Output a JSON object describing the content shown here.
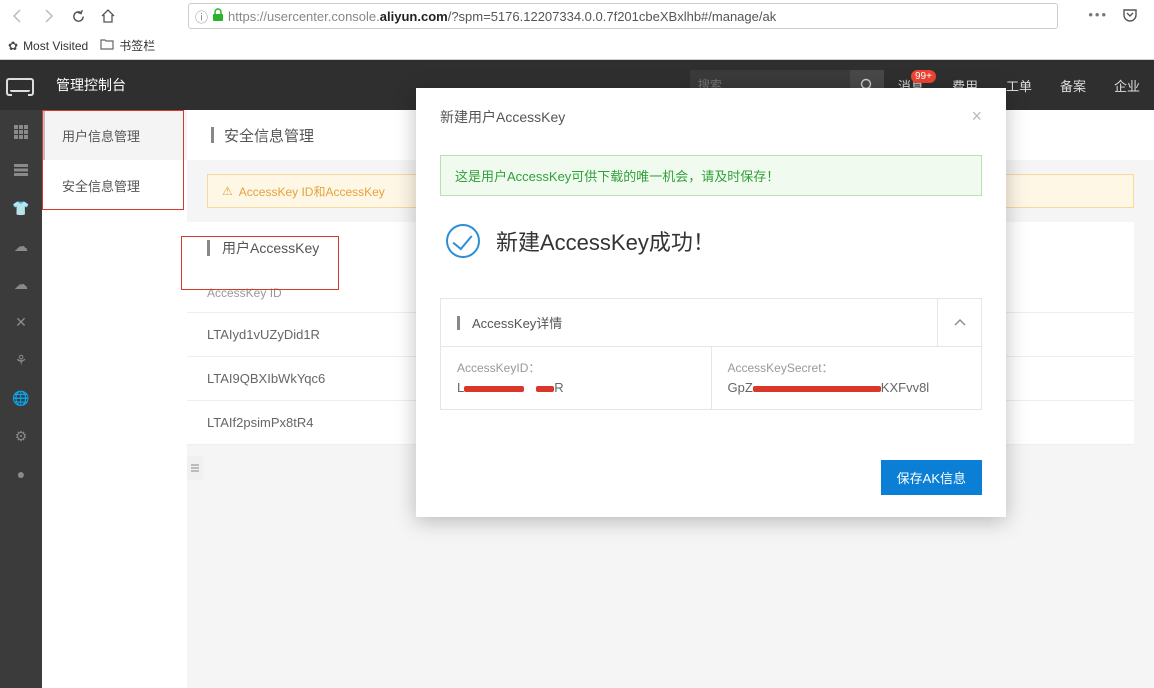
{
  "browser": {
    "url_prefix": "https://usercenter.console.",
    "url_bold": "aliyun.com",
    "url_suffix": "/?spm=5176.12207334.0.0.7f201cbeXBxlhb#/manage/ak",
    "most_visited": "Most Visited",
    "bookmarks_folder": "书签栏"
  },
  "console": {
    "title": "管理控制台",
    "search_placeholder": "搜索",
    "badge": "99+",
    "links": [
      "消息",
      "费用",
      "工单",
      "备案",
      "企业"
    ]
  },
  "sidebar": {
    "items": [
      "用户信息管理",
      "安全信息管理"
    ]
  },
  "page": {
    "title": "安全信息管理",
    "alert": "AccessKey ID和AccessKey",
    "tab_title": "用户AccessKey",
    "col_header": "AccessKey ID",
    "rows": [
      "LTAIyd1vUZyDid1R",
      "LTAI9QBXIbWkYqc6",
      "LTAIf2psimPx8tR4"
    ]
  },
  "modal": {
    "title": "新建用户AccessKey",
    "green_alert": "这是用户AccessKey可供下载的唯一机会，请及时保存！",
    "success": "新建AccessKey成功！",
    "details_title": "AccessKey详情",
    "id_label": "AccessKeyID：",
    "id_prefix": "L",
    "id_suffix": "R",
    "secret_label": "AccessKeySecret：",
    "secret_prefix": "GpZ",
    "secret_suffix": "KXFvv8l",
    "button": "保存AK信息"
  }
}
